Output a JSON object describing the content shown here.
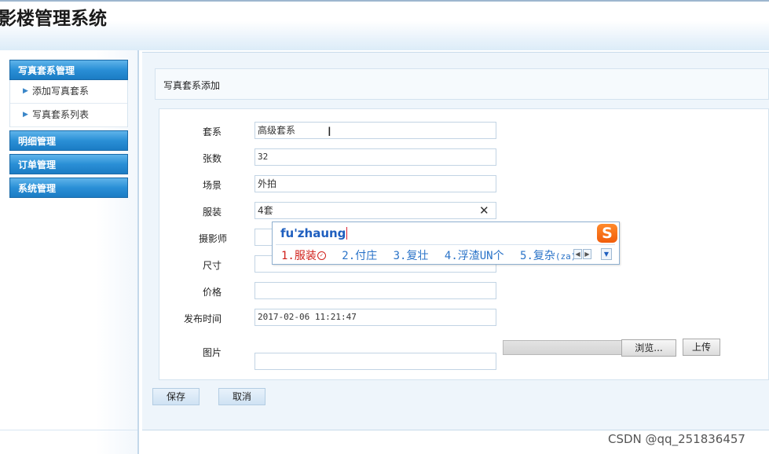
{
  "app": {
    "title": "影楼管理系统"
  },
  "sidebar": {
    "groups": [
      {
        "label": "写真套系管理",
        "items": [
          {
            "label": "添加写真套系"
          },
          {
            "label": "写真套系列表"
          }
        ]
      },
      {
        "label": "明细管理"
      },
      {
        "label": "订单管理"
      },
      {
        "label": "系统管理"
      }
    ]
  },
  "breadcrumb": {
    "label": "写真套系添加"
  },
  "form": {
    "series": {
      "label": "套系",
      "value": "高级套系"
    },
    "count": {
      "label": "张数",
      "value": "32"
    },
    "scene": {
      "label": "场景",
      "value": "外拍"
    },
    "costume": {
      "label": "服装",
      "value": "4套"
    },
    "photographer": {
      "label": "摄影师",
      "value": ""
    },
    "size": {
      "label": "尺寸",
      "value": ""
    },
    "price": {
      "label": "价格",
      "value": ""
    },
    "publish_time": {
      "label": "发布时间",
      "value": "2017-02-06 11:21:47"
    },
    "image": {
      "label": "图片",
      "value": "",
      "browse_label": "浏览...",
      "upload_label": "上传"
    }
  },
  "actions": {
    "save_label": "保存",
    "cancel_label": "取消"
  },
  "ime": {
    "pinyin": "fu'zhaung",
    "logo": "S",
    "candidates": [
      {
        "num": "1.",
        "text": "服装"
      },
      {
        "num": "2.",
        "text": "付庄"
      },
      {
        "num": "3.",
        "text": "复壮"
      },
      {
        "num": "4.",
        "text": "浮渣UN个"
      },
      {
        "num": "5.",
        "text": "复杂",
        "hint": "(za)"
      }
    ]
  },
  "watermark": "CSDN @qq_251836457"
}
